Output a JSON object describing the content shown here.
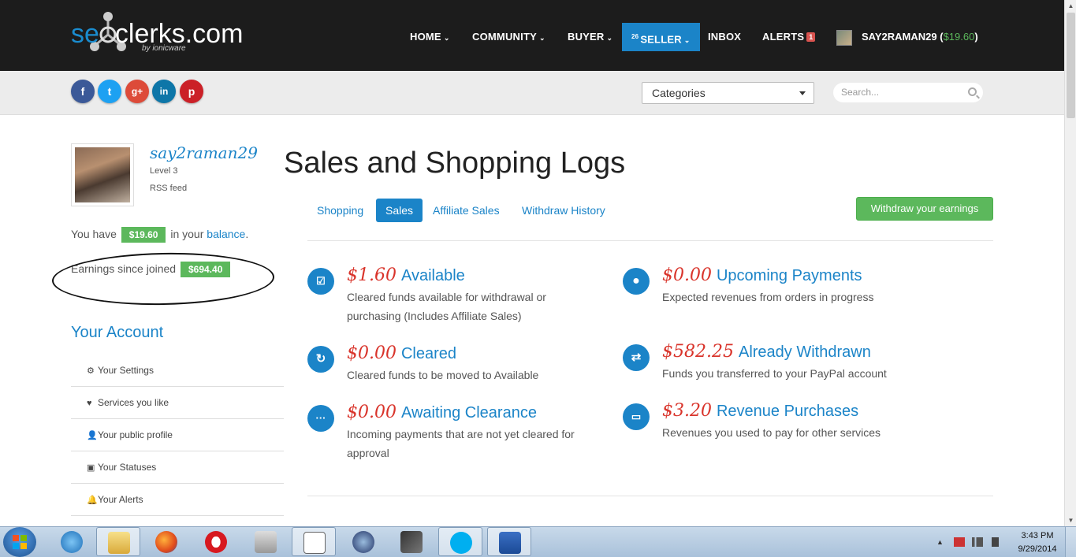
{
  "header": {
    "logo_main_pre": "se",
    "logo_main_post": "clerks.com",
    "logo_sub": "by ionicware",
    "nav": [
      {
        "label": "HOME"
      },
      {
        "label": "COMMUNITY"
      },
      {
        "label": "BUYER"
      },
      {
        "label": "SELLER",
        "count": "26"
      },
      {
        "label": "INBOX"
      },
      {
        "label": "ALERTS",
        "badge": "1"
      }
    ],
    "user": {
      "name": "SAY2RAMAN29",
      "balance": "$19.60"
    }
  },
  "subbar": {
    "social": [
      {
        "name": "facebook",
        "glyph": "f",
        "color": "#3b5998"
      },
      {
        "name": "twitter",
        "glyph": "t",
        "color": "#1da1f2"
      },
      {
        "name": "google-plus",
        "glyph": "g+",
        "color": "#dd4b39"
      },
      {
        "name": "linkedin",
        "glyph": "in",
        "color": "#0e76a8"
      },
      {
        "name": "pinterest",
        "glyph": "p",
        "color": "#cb2027"
      }
    ],
    "categories_label": "Categories",
    "search_placeholder": "Search..."
  },
  "sidebar": {
    "username": "say2raman29",
    "level": "Level 3",
    "rss": "RSS feed",
    "have_pre": "You have",
    "have_amount": "$19.60",
    "have_mid": "in your",
    "have_link": "balance",
    "earn_label": "Earnings since joined",
    "earn_amount": "$694.40",
    "account_title": "Your Account",
    "menu": [
      {
        "label": "Your Settings",
        "icon": "gears-icon"
      },
      {
        "label": "Services you like",
        "icon": "heart-icon"
      },
      {
        "label": "Your public profile",
        "icon": "user-icon"
      },
      {
        "label": "Your Statuses",
        "icon": "status-icon"
      },
      {
        "label": "Your Alerts",
        "icon": "bell-icon"
      }
    ]
  },
  "main": {
    "title": "Sales and Shopping Logs",
    "tabs": [
      {
        "label": "Shopping"
      },
      {
        "label": "Sales"
      },
      {
        "label": "Affiliate Sales"
      },
      {
        "label": "Withdraw History"
      }
    ],
    "withdraw_label": "Withdraw your earnings",
    "stats": [
      {
        "amount": "$1.60",
        "title": "Available",
        "desc1": "Cleared funds available for withdrawal or",
        "desc2": "purchasing (Includes Affiliate Sales)",
        "icon": "check-icon"
      },
      {
        "amount": "$0.00",
        "title": "Upcoming Payments",
        "desc1": "Expected revenues from orders in progress",
        "desc2": "",
        "icon": "circle-icon"
      },
      {
        "amount": "$0.00",
        "title": "Cleared",
        "desc1": "Cleared funds to be moved to Available",
        "desc2": "",
        "icon": "refresh-icon"
      },
      {
        "amount": "$582.25",
        "title": "Already Withdrawn",
        "desc1": "Funds you transferred to your PayPal account",
        "desc2": "",
        "icon": "exchange-icon"
      },
      {
        "amount": "$0.00",
        "title": "Awaiting Clearance",
        "desc1": "Incoming payments that are not yet cleared for",
        "desc2": "approval",
        "icon": "ellipsis-icon"
      },
      {
        "amount": "$3.20",
        "title": "Revenue Purchases",
        "desc1": "Revenues you used to pay for other services",
        "desc2": "",
        "icon": "card-icon"
      }
    ]
  },
  "taskbar": {
    "time": "3:43 PM",
    "date": "9/29/2014"
  }
}
